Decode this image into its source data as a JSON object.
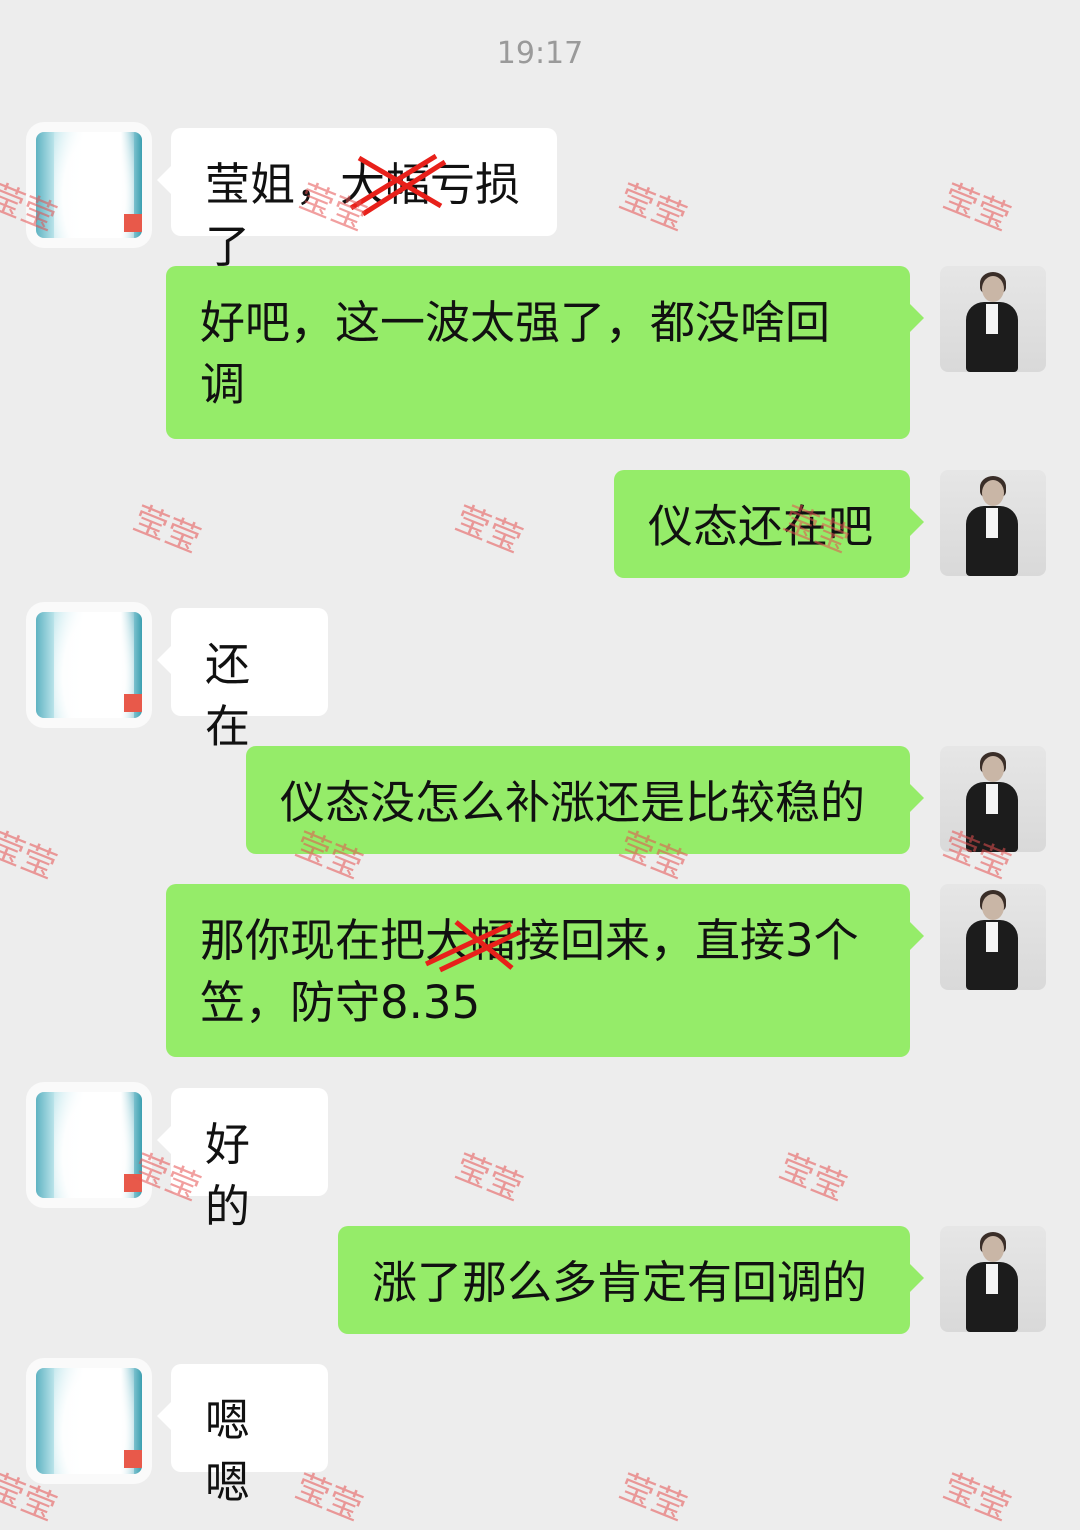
{
  "timestamp": "19:17",
  "watermark": "莹莹",
  "messages": [
    {
      "side": "left",
      "text": "莹姐，大幅亏损了"
    },
    {
      "side": "right",
      "text": "好吧，这一波太强了，都没啥回\n调"
    },
    {
      "side": "right",
      "text": "仪态还在吧"
    },
    {
      "side": "left",
      "text": "还在"
    },
    {
      "side": "right",
      "text": "仪态没怎么补涨还是比较稳的"
    },
    {
      "side": "right",
      "text": "那你现在把大幅接回来，直接3个\n笠，防守8.35"
    },
    {
      "side": "left",
      "text": "好的"
    },
    {
      "side": "right",
      "text": "涨了那么多肯定有回调的"
    },
    {
      "side": "left",
      "text": "嗯嗯"
    }
  ]
}
